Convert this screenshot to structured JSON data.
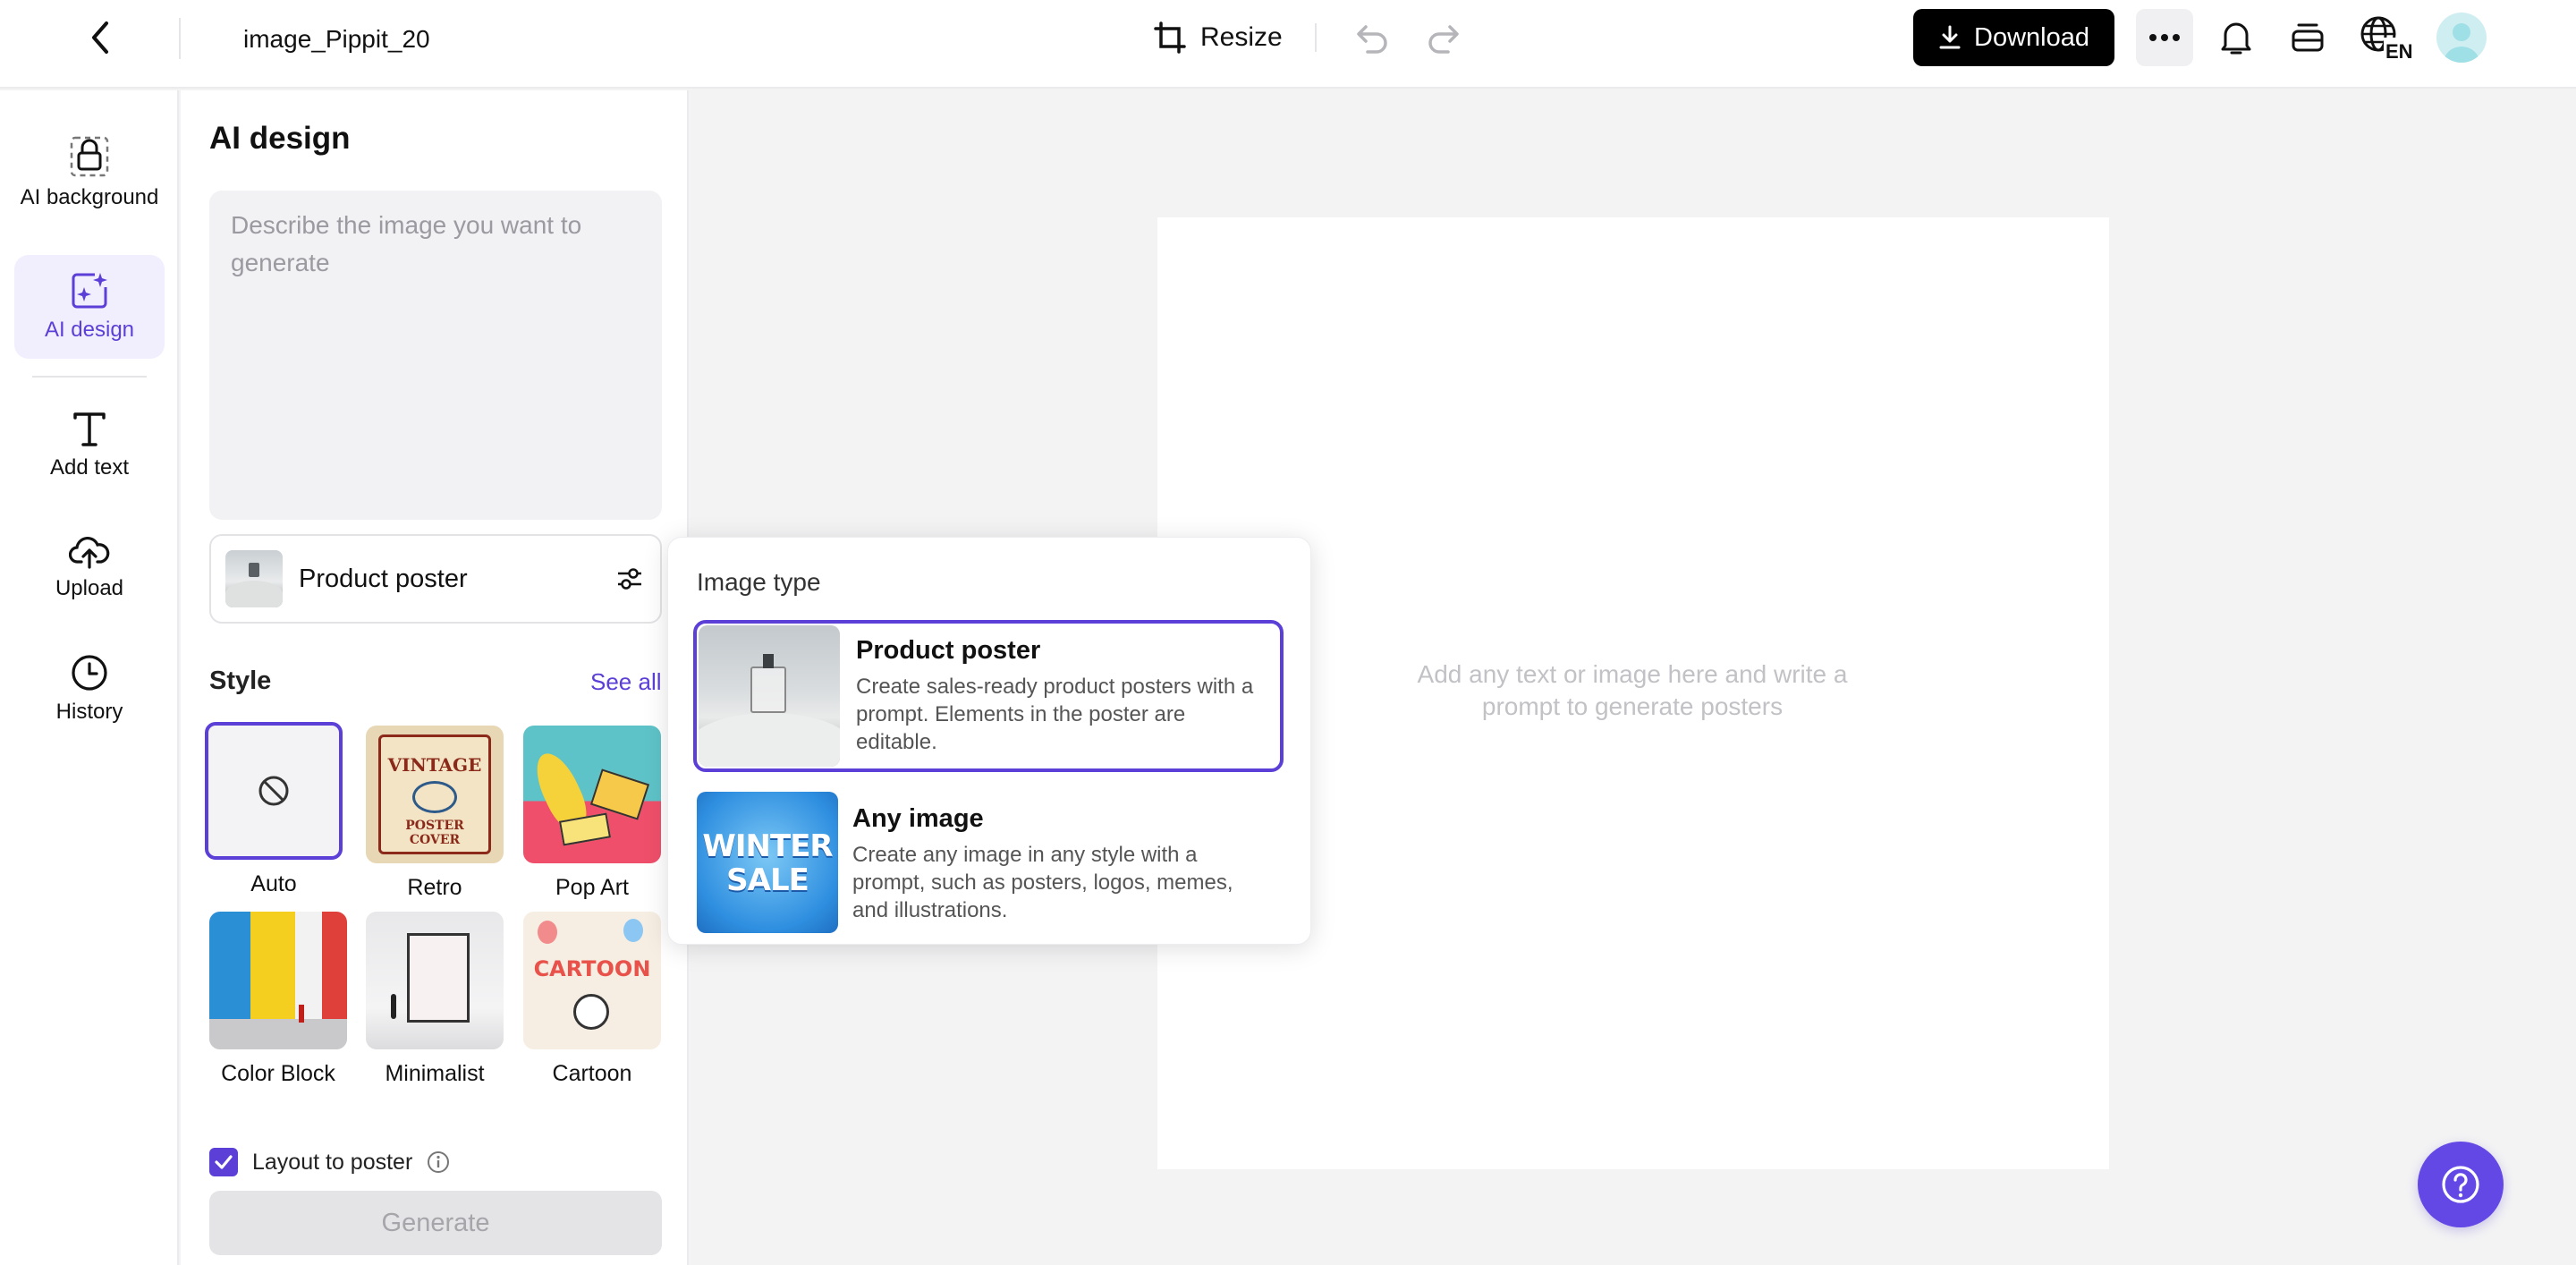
{
  "header": {
    "file_title": "image_Pippit_20",
    "resize_label": "Resize",
    "download_label": "Download",
    "lang_code": "EN",
    "icons": [
      "back-arrow-icon",
      "resize-icon",
      "undo-icon",
      "redo-icon",
      "download-icon",
      "more-icon",
      "bell-icon",
      "layers-icon",
      "globe-icon",
      "avatar"
    ]
  },
  "rail": {
    "items": [
      {
        "label": "AI background",
        "icon": "bag-dashed-icon",
        "active": false
      },
      {
        "label": "AI design",
        "icon": "image-sparkle-icon",
        "active": true
      },
      {
        "label": "Add text",
        "icon": "text-t-icon",
        "active": false
      },
      {
        "label": "Upload",
        "icon": "cloud-upload-icon",
        "active": false
      },
      {
        "label": "History",
        "icon": "clock-icon",
        "active": false
      }
    ]
  },
  "panel": {
    "title": "AI design",
    "prompt_placeholder": "Describe the image you want to generate",
    "prompt_value": "",
    "image_type_selected": "Product poster",
    "style_title": "Style",
    "see_all_label": "See all",
    "styles": [
      {
        "name": "Auto",
        "selected": true
      },
      {
        "name": "Retro",
        "selected": false
      },
      {
        "name": "Pop Art",
        "selected": false
      },
      {
        "name": "Color Block",
        "selected": false
      },
      {
        "name": "Minimalist",
        "selected": false
      },
      {
        "name": "Cartoon",
        "selected": false
      }
    ],
    "layout_to_poster_label": "Layout to poster",
    "layout_to_poster_checked": true,
    "generate_label": "Generate",
    "retro_thumb_text": [
      "VINTAGE",
      "POSTER",
      "COVER"
    ],
    "cartoon_thumb_text": "CARTOON"
  },
  "dropdown": {
    "title": "Image type",
    "options": [
      {
        "name": "Product poster",
        "desc": "Create sales-ready product posters with a prompt. Elements in the poster are editable.",
        "selected": true
      },
      {
        "name": "Any image",
        "desc": "Create any image in any style with a prompt, such as posters, logos, memes, and illustrations.",
        "selected": false,
        "thumb_text": [
          "WINTER",
          "SALE"
        ]
      }
    ]
  },
  "canvas": {
    "hint": "Add any text or image here and write a prompt to generate posters"
  },
  "colors": {
    "accent": "#5b3fd6",
    "help_button": "#6448e6",
    "download_bg": "#000000"
  }
}
